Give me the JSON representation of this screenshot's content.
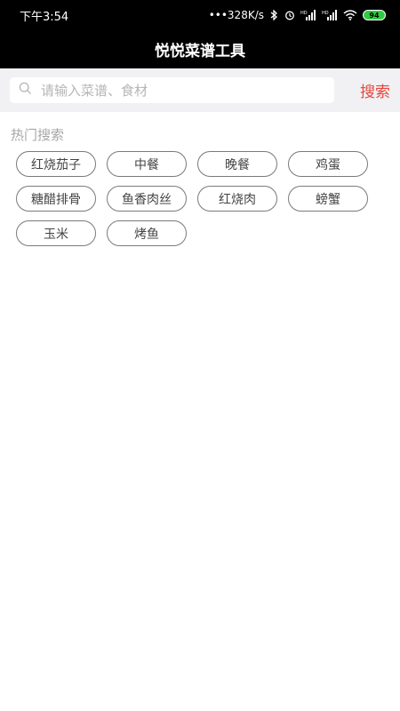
{
  "status_bar": {
    "time": "下午3:54",
    "network_speed": "•••328K/s",
    "battery": "94"
  },
  "header": {
    "title": "悦悦菜谱工具"
  },
  "search": {
    "placeholder": "请输入菜谱、食材",
    "button_label": "搜索"
  },
  "hot_search": {
    "title": "热门搜索",
    "tags": [
      "红烧茄子",
      "中餐",
      "晚餐",
      "鸡蛋",
      "糖醋排骨",
      "鱼香肉丝",
      "红烧肉",
      "螃蟹",
      "玉米",
      "烤鱼"
    ]
  },
  "colors": {
    "accent": "#e8453c",
    "header_bg": "#000000",
    "search_bg": "#f1f1f3"
  }
}
